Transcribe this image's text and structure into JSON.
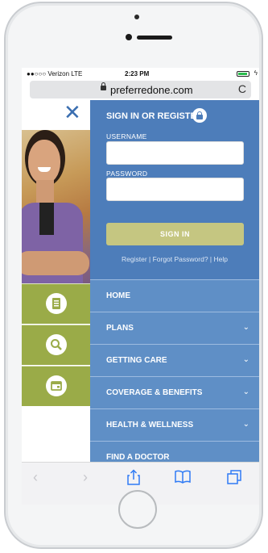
{
  "status": {
    "carrier": "●●○○○ Verizon  LTE",
    "time": "2:23 PM"
  },
  "browser": {
    "url": "preferredone.com",
    "reload": "C"
  },
  "close": "✕",
  "signin": {
    "title": "SIGN IN OR REGISTER",
    "username_label": "USERNAME",
    "password_label": "PASSWORD",
    "username_value": "",
    "password_value": "",
    "button_label": "SIGN IN",
    "links": "Register | Forgot Password? | Help"
  },
  "nav": [
    {
      "label": "HOME",
      "has_chevron": false
    },
    {
      "label": "PLANS",
      "has_chevron": true
    },
    {
      "label": "GETTING CARE",
      "has_chevron": true
    },
    {
      "label": "COVERAGE & BENEFITS",
      "has_chevron": true
    },
    {
      "label": "HEALTH & WELLNESS",
      "has_chevron": true
    },
    {
      "label": "FIND A DOCTOR",
      "has_chevron": false
    }
  ],
  "chevron": "⌄",
  "icons": [
    "document-icon",
    "search-icon",
    "calendar-icon"
  ],
  "toolbar": {
    "back": "‹",
    "forward": "›",
    "share": "⇪",
    "bookmarks": "📖",
    "tabs": "❐"
  },
  "colors": {
    "panel_blue": "#4d7dba",
    "nav_blue": "#5f8fc6",
    "tile_green": "#9aab48",
    "button_olive": "#c5c681",
    "close_blue": "#3a6eb0"
  }
}
